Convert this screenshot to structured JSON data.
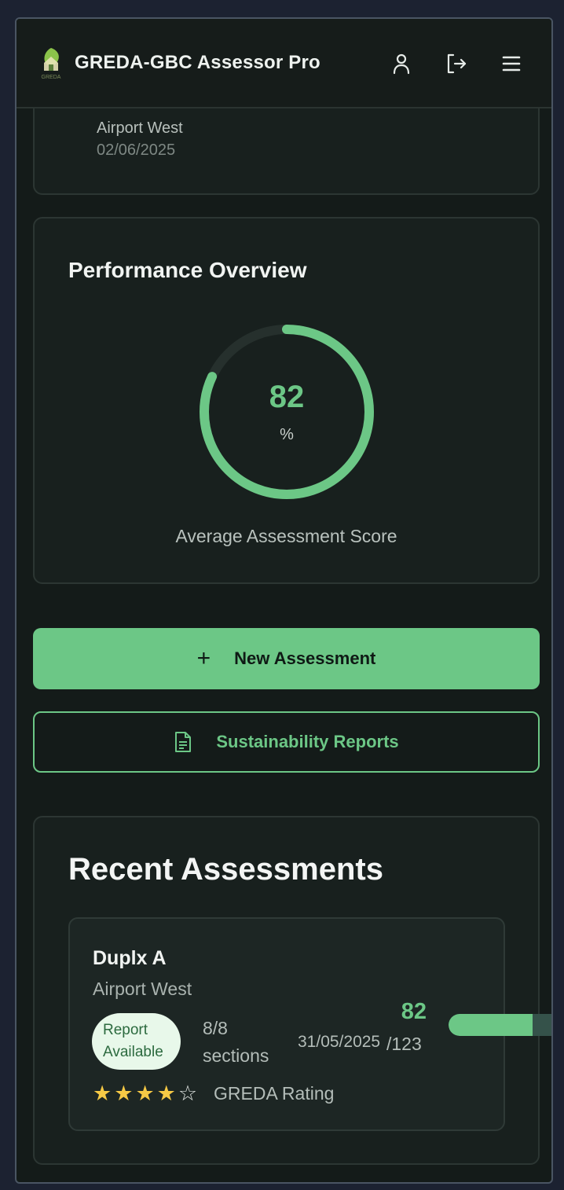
{
  "app": {
    "title": "GREDA-GBC Assessor Pro",
    "logo_text": "GREDA"
  },
  "header_icons": [
    "user-icon",
    "logout-icon",
    "menu-icon"
  ],
  "previous_card": {
    "location": "Airport West",
    "date": "02/06/2025"
  },
  "performance": {
    "title": "Performance Overview",
    "score": "82",
    "unit": "%",
    "score_fraction": 0.82,
    "caption": "Average Assessment Score"
  },
  "actions": {
    "new_assessment": "New Assessment",
    "sustainability_reports": "Sustainability Reports"
  },
  "recent": {
    "title": "Recent Assessments",
    "items": [
      {
        "name": "Duplx A",
        "location": "Airport West",
        "badge": "Report Available",
        "sections": "8/8 sections",
        "date": "31/05/2025",
        "score": "82",
        "out_of": "/123",
        "progress_fraction": 0.667,
        "stars": 4,
        "stars_max": 5,
        "rating_label": "GREDA Rating"
      }
    ]
  },
  "colors": {
    "accent": "#6cc786",
    "background": "#141b19",
    "star": "#f6c945"
  }
}
